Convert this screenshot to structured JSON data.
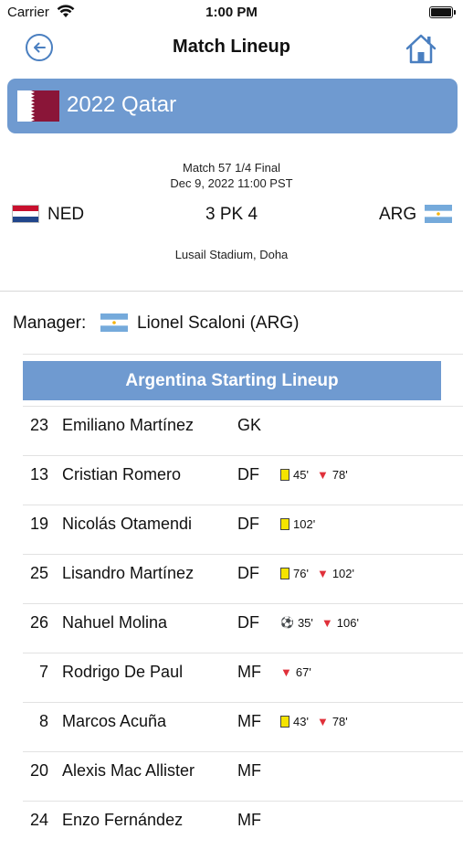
{
  "status_bar": {
    "carrier": "Carrier",
    "time": "1:00 PM"
  },
  "nav": {
    "title": "Match Lineup",
    "back_icon": "back-arrow-circle-icon",
    "home_icon": "home-icon"
  },
  "tournament": {
    "title": "2022 Qatar",
    "flag": "qatar-flag"
  },
  "match": {
    "round": "Match 57 1/4 Final",
    "datetime": "Dec 9, 2022 11:00 PST",
    "home_code": "NED",
    "score": "3 PK 4",
    "away_code": "ARG",
    "venue": "Lusail Stadium, Doha"
  },
  "manager": {
    "label": "Manager:",
    "name": "Lionel Scaloni (ARG)"
  },
  "lineup": {
    "header": "Argentina Starting Lineup",
    "players": [
      {
        "number": "23",
        "name": "Emiliano Martínez",
        "position": "GK",
        "events": []
      },
      {
        "number": "13",
        "name": "Cristian Romero",
        "position": "DF",
        "events": [
          {
            "type": "yellow-card",
            "minute": "45'"
          },
          {
            "type": "sub-out",
            "minute": "78'"
          }
        ]
      },
      {
        "number": "19",
        "name": "Nicolás Otamendi",
        "position": "DF",
        "events": [
          {
            "type": "yellow-card",
            "minute": "102'"
          }
        ]
      },
      {
        "number": "25",
        "name": "Lisandro Martínez",
        "position": "DF",
        "events": [
          {
            "type": "yellow-card",
            "minute": "76'"
          },
          {
            "type": "sub-out",
            "minute": "102'"
          }
        ]
      },
      {
        "number": "26",
        "name": "Nahuel Molina",
        "position": "DF",
        "events": [
          {
            "type": "goal",
            "minute": "35'"
          },
          {
            "type": "sub-out",
            "minute": "106'"
          }
        ]
      },
      {
        "number": "7",
        "name": "Rodrigo De Paul",
        "position": "MF",
        "events": [
          {
            "type": "sub-out",
            "minute": "67'"
          }
        ]
      },
      {
        "number": "8",
        "name": "Marcos Acuña",
        "position": "MF",
        "events": [
          {
            "type": "yellow-card",
            "minute": "43'"
          },
          {
            "type": "sub-out",
            "minute": "78'"
          }
        ]
      },
      {
        "number": "20",
        "name": "Alexis Mac Allister",
        "position": "MF",
        "events": []
      },
      {
        "number": "24",
        "name": "Enzo Fernández",
        "position": "MF",
        "events": []
      }
    ]
  },
  "colors": {
    "accent": "#4a7fc0",
    "banner": "#6f9ad0",
    "yellow_card": "#f5e400",
    "sub_out": "#e0303a"
  }
}
